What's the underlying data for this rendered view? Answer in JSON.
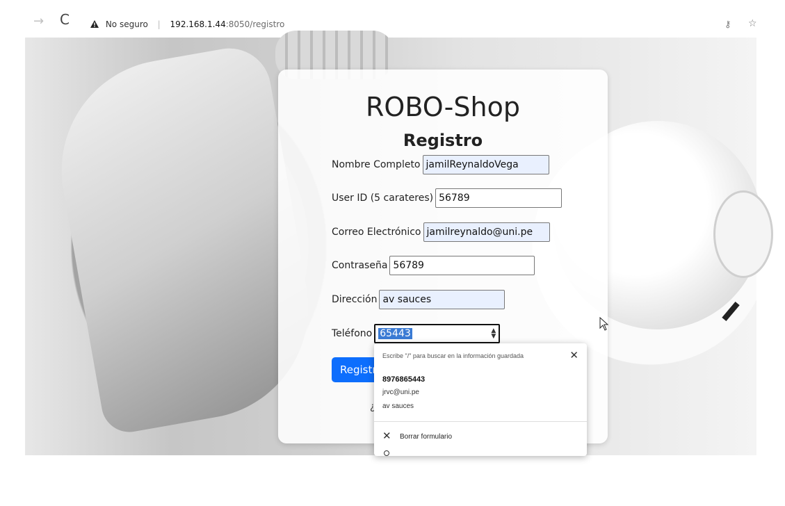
{
  "browser": {
    "security_label": "No seguro",
    "url_host": "192.168.1.44",
    "url_rest": ":8050/registro",
    "icons": [
      "forward-icon",
      "reload-icon",
      "warning-icon",
      "key-icon",
      "star-icon"
    ]
  },
  "form": {
    "title": "ROBO-Shop",
    "subtitle": "Registro",
    "fields": [
      {
        "label": "Nombre Completo",
        "value": "jamilReynaldoVega"
      },
      {
        "label": "User ID (5 carateres)",
        "value": "56789"
      },
      {
        "label": "Correo Electrónico",
        "value": "jamilreynaldo@uni.pe"
      },
      {
        "label": "Contraseña",
        "value": "56789"
      },
      {
        "label": "Dirección",
        "value": "av sauces"
      },
      {
        "label": "Teléfono",
        "value": "65443"
      }
    ],
    "submit_label": "Registrar",
    "login_prompt_visible": "¿"
  },
  "autofill": {
    "hint": "Escribe \"/\" para buscar en la información guardada",
    "suggestion_main": "8976865443",
    "suggestion_line2": "jrvc@uni.pe",
    "suggestion_line3": "av sauces",
    "clear_label": "Borrar formulario"
  }
}
